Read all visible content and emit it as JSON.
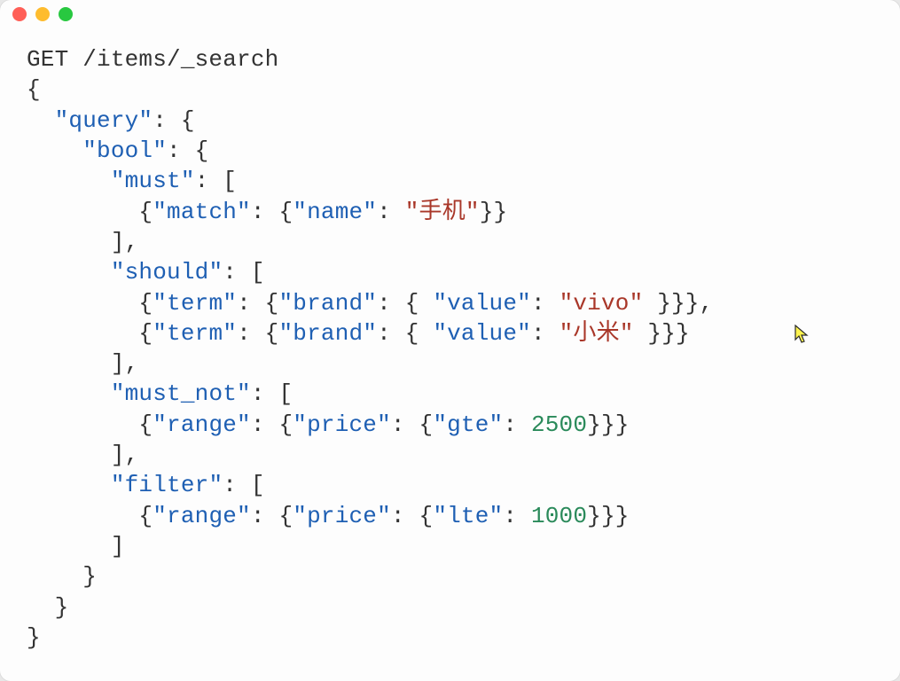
{
  "request": {
    "method_line": "GET /items/_search"
  },
  "query": {
    "open_brace": "{",
    "close_brace": "}",
    "query_key": "\"query\"",
    "bool_key": "\"bool\"",
    "must_key": "\"must\"",
    "should_key": "\"should\"",
    "must_not_key": "\"must_not\"",
    "filter_key": "\"filter\"",
    "match_key": "\"match\"",
    "term_key": "\"term\"",
    "range_key": "\"range\"",
    "name_key": "\"name\"",
    "brand_key": "\"brand\"",
    "value_key": "\"value\"",
    "price_key": "\"price\"",
    "gte_key": "\"gte\"",
    "lte_key": "\"lte\"",
    "name_val": "\"手机\"",
    "brand_val1": "\"vivo\"",
    "brand_val2": "\"小米\"",
    "gte_val": "2500",
    "lte_val": "1000"
  },
  "punct": {
    "colon_sp": ": ",
    "colon_brace": ": {",
    "colon_bracket": ": [",
    "brace_open": "{",
    "brace_close": "}",
    "brace_close_comma": "},",
    "dbl_brace_close": "}}",
    "triple_brace_close": "}}}",
    "triple_brace_close_comma": "}}},",
    "bracket_close": "]",
    "bracket_close_comma": "],",
    "sp_brace_close": " }"
  }
}
